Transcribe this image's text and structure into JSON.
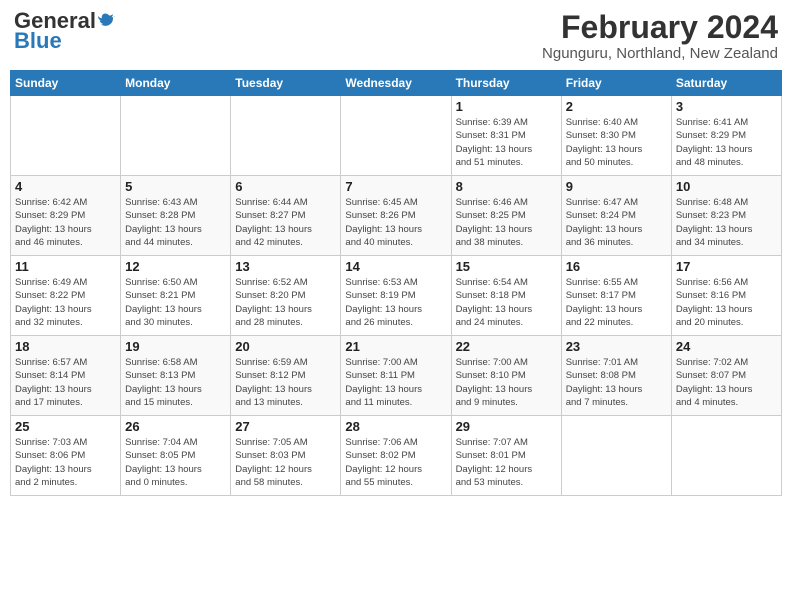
{
  "header": {
    "logo_general": "General",
    "logo_blue": "Blue",
    "title": "February 2024",
    "subtitle": "Ngunguru, Northland, New Zealand"
  },
  "weekdays": [
    "Sunday",
    "Monday",
    "Tuesday",
    "Wednesday",
    "Thursday",
    "Friday",
    "Saturday"
  ],
  "weeks": [
    [
      {
        "day": "",
        "info": ""
      },
      {
        "day": "",
        "info": ""
      },
      {
        "day": "",
        "info": ""
      },
      {
        "day": "",
        "info": ""
      },
      {
        "day": "1",
        "info": "Sunrise: 6:39 AM\nSunset: 8:31 PM\nDaylight: 13 hours\nand 51 minutes."
      },
      {
        "day": "2",
        "info": "Sunrise: 6:40 AM\nSunset: 8:30 PM\nDaylight: 13 hours\nand 50 minutes."
      },
      {
        "day": "3",
        "info": "Sunrise: 6:41 AM\nSunset: 8:29 PM\nDaylight: 13 hours\nand 48 minutes."
      }
    ],
    [
      {
        "day": "4",
        "info": "Sunrise: 6:42 AM\nSunset: 8:29 PM\nDaylight: 13 hours\nand 46 minutes."
      },
      {
        "day": "5",
        "info": "Sunrise: 6:43 AM\nSunset: 8:28 PM\nDaylight: 13 hours\nand 44 minutes."
      },
      {
        "day": "6",
        "info": "Sunrise: 6:44 AM\nSunset: 8:27 PM\nDaylight: 13 hours\nand 42 minutes."
      },
      {
        "day": "7",
        "info": "Sunrise: 6:45 AM\nSunset: 8:26 PM\nDaylight: 13 hours\nand 40 minutes."
      },
      {
        "day": "8",
        "info": "Sunrise: 6:46 AM\nSunset: 8:25 PM\nDaylight: 13 hours\nand 38 minutes."
      },
      {
        "day": "9",
        "info": "Sunrise: 6:47 AM\nSunset: 8:24 PM\nDaylight: 13 hours\nand 36 minutes."
      },
      {
        "day": "10",
        "info": "Sunrise: 6:48 AM\nSunset: 8:23 PM\nDaylight: 13 hours\nand 34 minutes."
      }
    ],
    [
      {
        "day": "11",
        "info": "Sunrise: 6:49 AM\nSunset: 8:22 PM\nDaylight: 13 hours\nand 32 minutes."
      },
      {
        "day": "12",
        "info": "Sunrise: 6:50 AM\nSunset: 8:21 PM\nDaylight: 13 hours\nand 30 minutes."
      },
      {
        "day": "13",
        "info": "Sunrise: 6:52 AM\nSunset: 8:20 PM\nDaylight: 13 hours\nand 28 minutes."
      },
      {
        "day": "14",
        "info": "Sunrise: 6:53 AM\nSunset: 8:19 PM\nDaylight: 13 hours\nand 26 minutes."
      },
      {
        "day": "15",
        "info": "Sunrise: 6:54 AM\nSunset: 8:18 PM\nDaylight: 13 hours\nand 24 minutes."
      },
      {
        "day": "16",
        "info": "Sunrise: 6:55 AM\nSunset: 8:17 PM\nDaylight: 13 hours\nand 22 minutes."
      },
      {
        "day": "17",
        "info": "Sunrise: 6:56 AM\nSunset: 8:16 PM\nDaylight: 13 hours\nand 20 minutes."
      }
    ],
    [
      {
        "day": "18",
        "info": "Sunrise: 6:57 AM\nSunset: 8:14 PM\nDaylight: 13 hours\nand 17 minutes."
      },
      {
        "day": "19",
        "info": "Sunrise: 6:58 AM\nSunset: 8:13 PM\nDaylight: 13 hours\nand 15 minutes."
      },
      {
        "day": "20",
        "info": "Sunrise: 6:59 AM\nSunset: 8:12 PM\nDaylight: 13 hours\nand 13 minutes."
      },
      {
        "day": "21",
        "info": "Sunrise: 7:00 AM\nSunset: 8:11 PM\nDaylight: 13 hours\nand 11 minutes."
      },
      {
        "day": "22",
        "info": "Sunrise: 7:00 AM\nSunset: 8:10 PM\nDaylight: 13 hours\nand 9 minutes."
      },
      {
        "day": "23",
        "info": "Sunrise: 7:01 AM\nSunset: 8:08 PM\nDaylight: 13 hours\nand 7 minutes."
      },
      {
        "day": "24",
        "info": "Sunrise: 7:02 AM\nSunset: 8:07 PM\nDaylight: 13 hours\nand 4 minutes."
      }
    ],
    [
      {
        "day": "25",
        "info": "Sunrise: 7:03 AM\nSunset: 8:06 PM\nDaylight: 13 hours\nand 2 minutes."
      },
      {
        "day": "26",
        "info": "Sunrise: 7:04 AM\nSunset: 8:05 PM\nDaylight: 13 hours\nand 0 minutes."
      },
      {
        "day": "27",
        "info": "Sunrise: 7:05 AM\nSunset: 8:03 PM\nDaylight: 12 hours\nand 58 minutes."
      },
      {
        "day": "28",
        "info": "Sunrise: 7:06 AM\nSunset: 8:02 PM\nDaylight: 12 hours\nand 55 minutes."
      },
      {
        "day": "29",
        "info": "Sunrise: 7:07 AM\nSunset: 8:01 PM\nDaylight: 12 hours\nand 53 minutes."
      },
      {
        "day": "",
        "info": ""
      },
      {
        "day": "",
        "info": ""
      }
    ]
  ]
}
